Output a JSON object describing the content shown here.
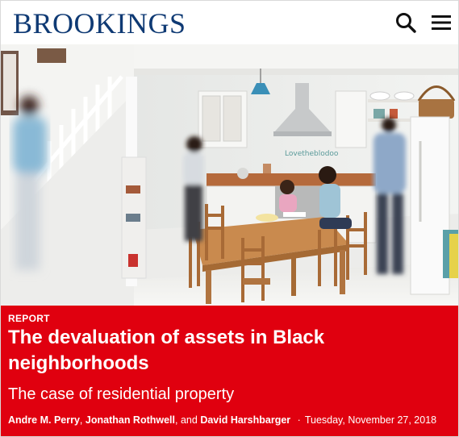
{
  "header": {
    "logo_text": "BROOKINGS",
    "search_icon": "search-icon",
    "menu_icon": "hamburger-menu-icon",
    "brand_color": "#0f3a74"
  },
  "banner": {
    "kicker": "REPORT",
    "title": "The devaluation of assets in Black neighborhoods",
    "subtitle": "The case of residential property",
    "authors": [
      "Andre M. Perry",
      "Jonathan Rothwell",
      "David Harshbarger"
    ],
    "author_sep_1": ",",
    "author_sep_2": ", and",
    "date_sep": "·",
    "date": "Tuesday, November 27, 2018",
    "color": "#e0000f"
  }
}
